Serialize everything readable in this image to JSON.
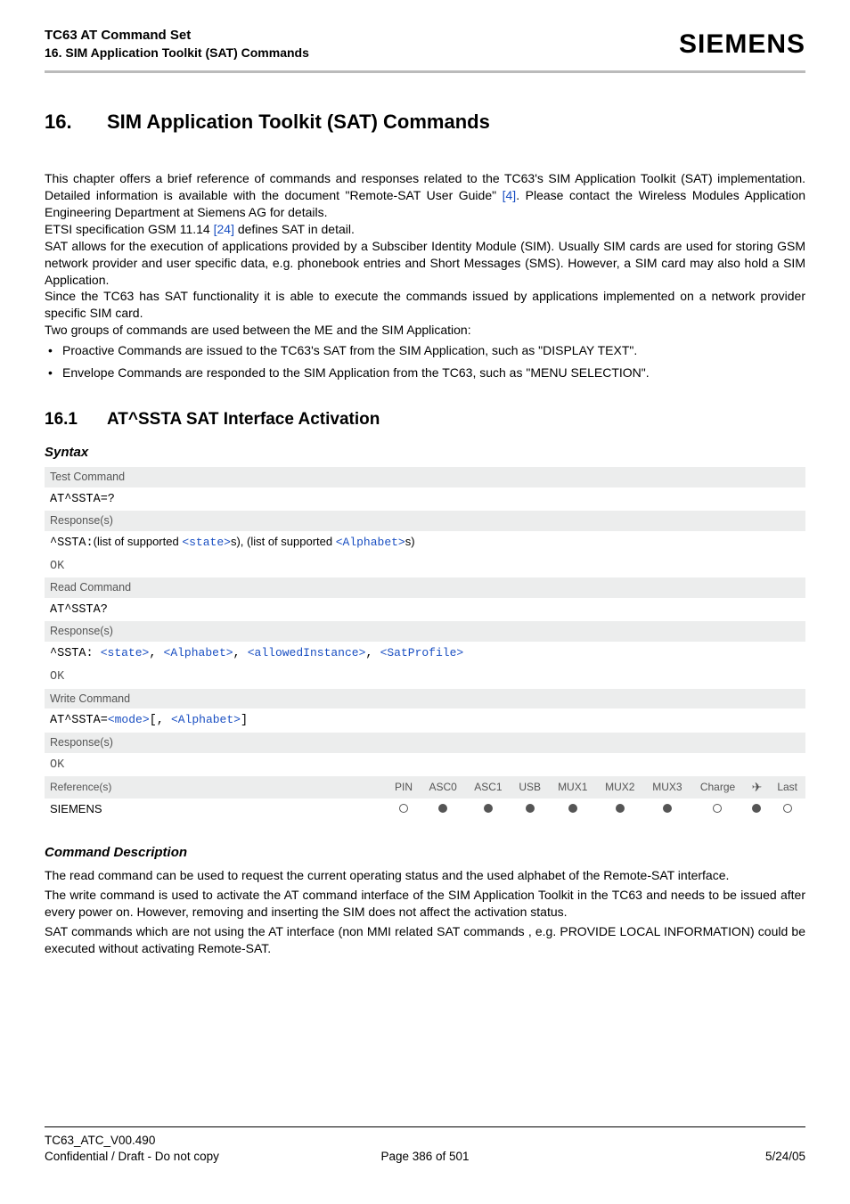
{
  "header": {
    "doc_title": "TC63 AT Command Set",
    "section_bread": "16. SIM Application Toolkit (SAT) Commands",
    "brand": "SIEMENS"
  },
  "chapter": {
    "num": "16.",
    "title": "SIM Application Toolkit (SAT) Commands"
  },
  "intro": {
    "p1a": "This chapter offers a brief reference of commands and responses related to the TC63's SIM Application Toolkit (SAT) implementation. Detailed information is available with the document \"Remote-SAT User Guide\" ",
    "ref4": "[4]",
    "p1b": ". Please contact the Wireless Modules Application Engineering Department at Siemens AG for details.",
    "p2a": "ETSI specification GSM 11.14 ",
    "ref24": "[24]",
    "p2b": " defines SAT in detail.",
    "p3": "SAT allows for the execution of applications provided by a Subsciber Identity Module (SIM). Usually SIM cards are used for storing GSM network provider and user specific data, e.g. phonebook entries and Short Messages (SMS). However, a SIM card may also hold a SIM Application.",
    "p4": "Since the TC63 has SAT functionality it is able to execute the commands issued by applications implemented on a network provider specific SIM card.",
    "p5": "Two groups of commands are used between the ME and the SIM Application:",
    "b1": "Proactive Commands are issued to the TC63's SAT from the SIM Application, such as \"DISPLAY TEXT\".",
    "b2": "Envelope Commands are responded to the SIM Application from the TC63, such as \"MENU SELECTION\"."
  },
  "section": {
    "num": "16.1",
    "title": "AT^SSTA   SAT Interface Activation"
  },
  "syntax_label": "Syntax",
  "syntax": {
    "test_cmd_label": "Test Command",
    "test_cmd": "AT^SSTA=?",
    "response_label": "Response(s)",
    "test_resp_prefix": "^SSTA:",
    "test_resp_mid1": "(list of supported ",
    "state": "<state>",
    "test_resp_mid2": "s), (list of supported ",
    "alphabet": "<Alphabet>",
    "test_resp_tail": "s)",
    "ok": "OK",
    "read_cmd_label": "Read Command",
    "read_cmd": "AT^SSTA?",
    "read_resp_prefix": "^SSTA: ",
    "comma": ", ",
    "allowedInstance": "<allowedInstance>",
    "satProfile": "<SatProfile>",
    "write_cmd_label": "Write Command",
    "write_cmd_prefix": "AT^SSTA=",
    "mode": "<mode>",
    "write_cmd_mid": "[, ",
    "write_cmd_tail": "]",
    "ref_label": "Reference(s)",
    "ref_value": "SIEMENS",
    "cols": {
      "pin": "PIN",
      "asc0": "ASC0",
      "asc1": "ASC1",
      "usb": "USB",
      "mux1": "MUX1",
      "mux2": "MUX2",
      "mux3": "MUX3",
      "charge": "Charge",
      "arrow": "✈",
      "last": "Last"
    }
  },
  "cmd_desc_label": "Command Description",
  "cmd_desc": {
    "p1": "The read command can be used to request the current operating status and the used alphabet of the Remote-SAT interface.",
    "p2": "The write command is used to activate the AT command interface of the SIM Application Toolkit in the TC63 and needs to be issued after every power on. However, removing and inserting the SIM does not affect the activation status.",
    "p3": "SAT commands which are not using the AT interface (non MMI related SAT commands , e.g. PROVIDE LOCAL INFORMATION) could be executed without activating Remote-SAT."
  },
  "footer": {
    "doc_id": "TC63_ATC_V00.490",
    "conf": "Confidential / Draft - Do not copy",
    "page": "Page 386 of 501",
    "date": "5/24/05"
  }
}
